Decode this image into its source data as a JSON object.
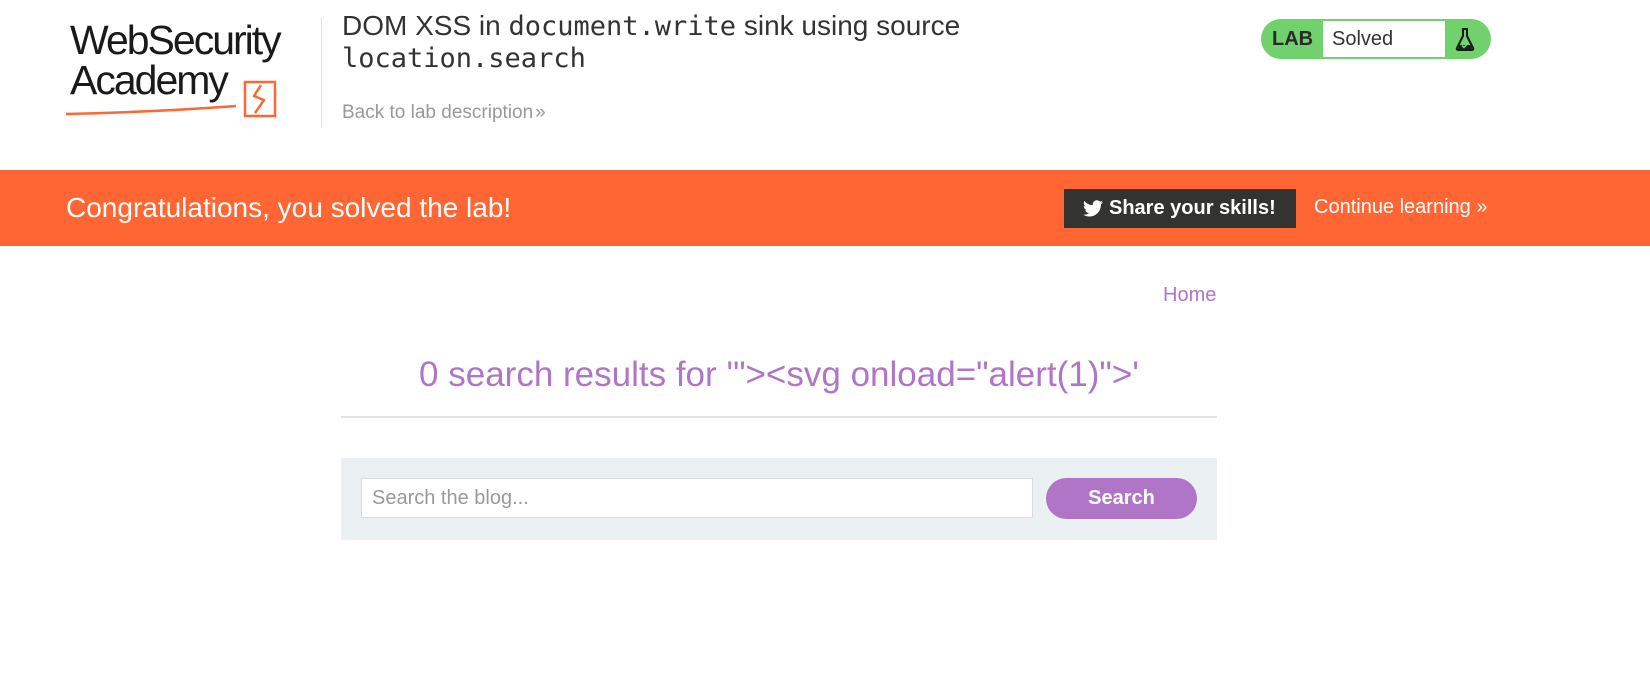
{
  "header": {
    "logo": {
      "line1": "WebSecurity",
      "line2": "Academy"
    },
    "title_prefix": "DOM XSS in ",
    "title_code1": "document.write",
    "title_middle": " sink using source ",
    "title_code2": "location.search",
    "back_link": "Back to lab description",
    "lab_badge": {
      "label": "LAB",
      "status": "Solved",
      "icon": "flask-icon"
    }
  },
  "banner": {
    "message": "Congratulations, you solved the lab!",
    "share_label": "Share your skills!",
    "share_icon": "twitter-icon",
    "continue_label": "Continue learning"
  },
  "main": {
    "home_link": "Home",
    "results_heading": "0 search results for '\"><svg onload=\"alert(1)\">'",
    "search": {
      "placeholder": "Search the blog...",
      "value": "",
      "button_label": "Search"
    }
  },
  "colors": {
    "accent_orange": "#ff6633",
    "link_purple": "#b075c6",
    "lab_green": "#70d16d",
    "dark_button": "#333332"
  }
}
